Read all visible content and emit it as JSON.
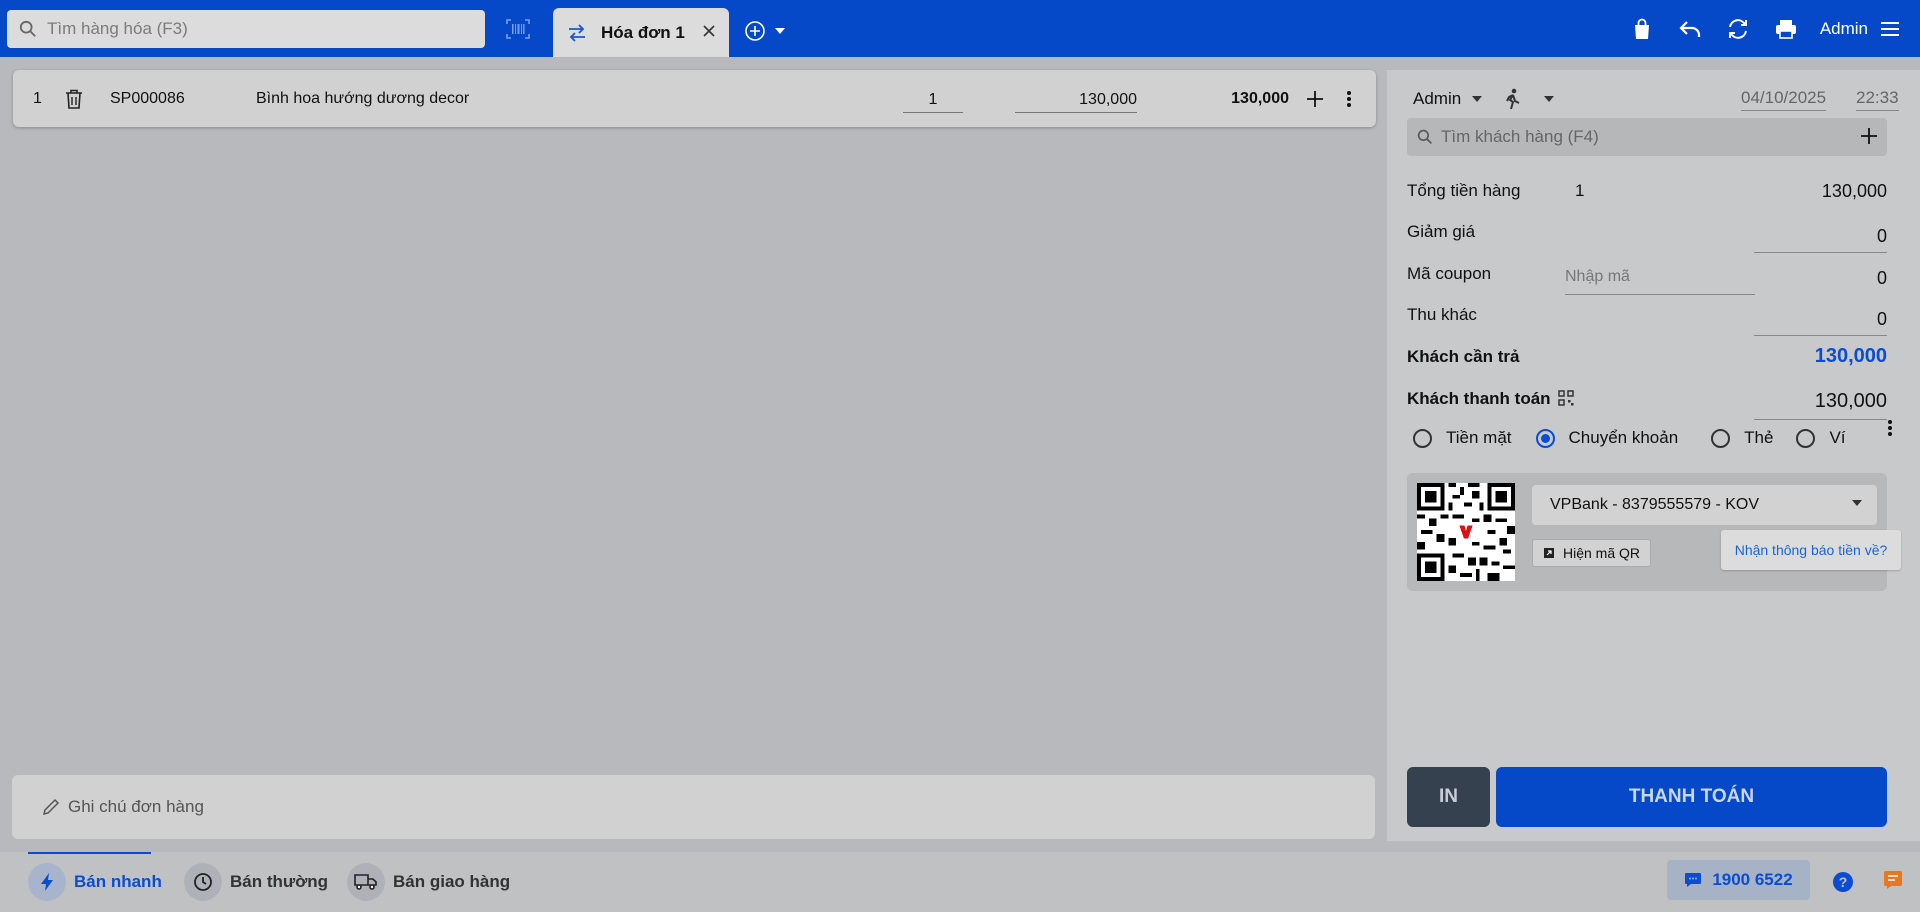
{
  "topbar": {
    "search_placeholder": "Tìm hàng hóa (F3)",
    "tab_label": "Hóa đơn 1",
    "user_label": "Admin"
  },
  "cart": {
    "items": [
      {
        "index": "1",
        "code": "SP000086",
        "name": "Bình hoa hướng dương decor",
        "qty": "1",
        "price": "130,000",
        "total": "130,000"
      }
    ]
  },
  "note": {
    "placeholder": "Ghi chú đơn hàng"
  },
  "panel": {
    "seller": "Admin",
    "date": "04/10/2025",
    "time": "22:33",
    "customer_search_placeholder": "Tìm khách hàng (F4)",
    "subtotal_label": "Tổng tiền hàng",
    "subtotal_count": "1",
    "subtotal_value": "130,000",
    "discount_label": "Giảm giá",
    "discount_value": "0",
    "coupon_label": "Mã coupon",
    "coupon_placeholder": "Nhập mã",
    "coupon_value": "0",
    "other_label": "Thu khác",
    "other_value": "0",
    "due_label": "Khách cần trả",
    "due_value": "130,000",
    "paid_label": "Khách thanh toán",
    "paid_value": "130,000",
    "methods": [
      "Tiền mặt",
      "Chuyển khoản",
      "Thẻ",
      "Ví"
    ],
    "selected_method": "Chuyển khoản",
    "bank_account": "VPBank - 8379555579 - KOV",
    "show_qr_label": "Hiện mã QR",
    "notify_link": "Nhận thông báo tiền về?",
    "print_button": "IN",
    "pay_button": "THANH TOÁN"
  },
  "bottombar": {
    "modes": [
      "Bán nhanh",
      "Bán thường",
      "Bán giao hàng"
    ],
    "active_mode": "Bán nhanh",
    "hotline": "1900 6522"
  },
  "colors": {
    "brand_blue": "#0548c8",
    "accent_blue": "#0a4dd2",
    "dark_button": "#36414f"
  }
}
